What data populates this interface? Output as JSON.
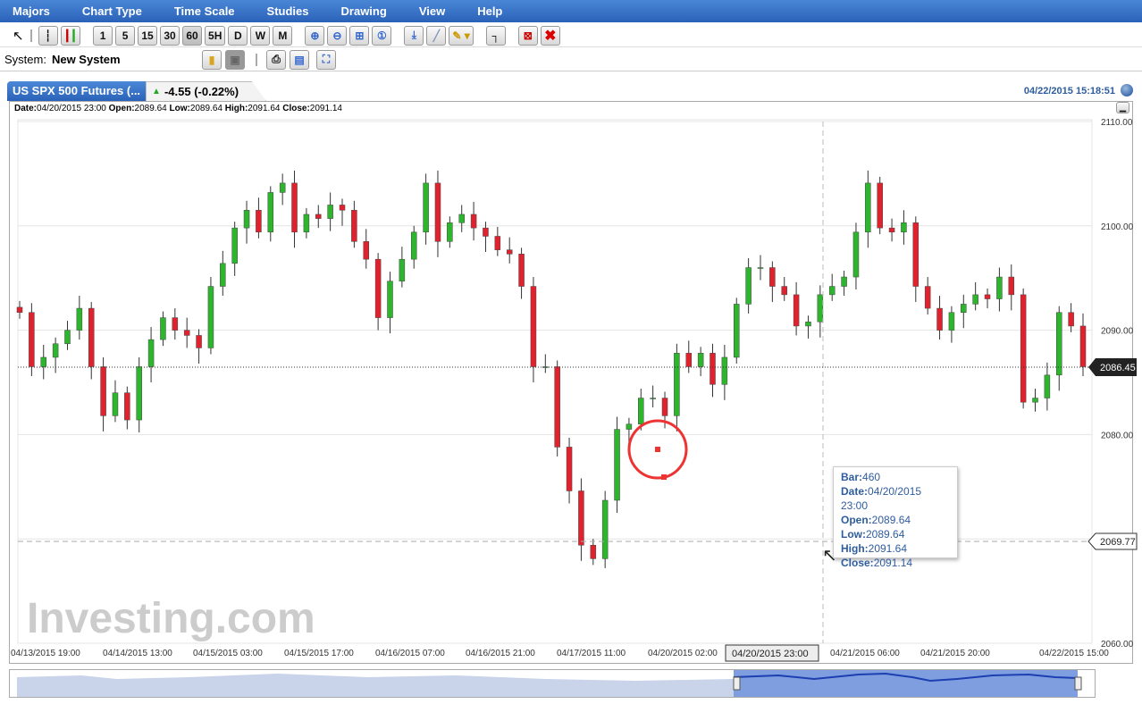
{
  "menu": [
    "Majors",
    "Chart Type",
    "Time Scale",
    "Studies",
    "Drawing",
    "View",
    "Help"
  ],
  "toolbar": {
    "intervals": [
      "1",
      "5",
      "15",
      "30",
      "60",
      "5H",
      "D",
      "W",
      "M"
    ],
    "active_interval": "60"
  },
  "system": {
    "label": "System:",
    "name": "New System"
  },
  "tab": {
    "title": "US SPX 500 Futures (...",
    "change": "-4.55 (-0.22%)"
  },
  "datetime": "04/22/2015 15:18:51",
  "info_line": {
    "date_label": "Date:",
    "date": "04/20/2015 23:00",
    "open_label": "Open:",
    "open": "2089.64",
    "low_label": "Low:",
    "low": "2089.64",
    "high_label": "High:",
    "high": "2091.64",
    "close_label": "Close:",
    "close": "2091.14"
  },
  "tooltip": {
    "bar_label": "Bar:",
    "bar": "460",
    "date_label": "Date:",
    "date": "04/20/2015 23:00",
    "open_label": "Open:",
    "open": "2089.64",
    "low_label": "Low:",
    "low": "2089.64",
    "high_label": "High:",
    "high": "2091.64",
    "close_label": "Close:",
    "close": "2091.14"
  },
  "watermark": "Investing.com",
  "chart_data": {
    "type": "candlestick",
    "ylim": [
      2060,
      2110
    ],
    "yticks": [
      "2110.00",
      "2100.00",
      "2090.00",
      "2080.00",
      "2070.00",
      "2060.00"
    ],
    "xticks": [
      "04/13/2015 19:00",
      "04/14/2015 13:00",
      "04/15/2015 03:00",
      "04/15/2015 17:00",
      "04/16/2015 07:00",
      "04/16/2015 21:00",
      "04/17/2015 11:00",
      "04/20/2015 02:00",
      "04/21/2015 06:00",
      "04/21/2015 20:00",
      "04/22/2015 15:00"
    ],
    "crosshair_x_label": "04/20/2015 23:00",
    "last_price": "2086.45",
    "crosshair_price": "2069.77",
    "closes": [
      2091.7,
      2086.5,
      2087.4,
      2088.7,
      2090,
      2092.1,
      2086.5,
      2081.8,
      2084,
      2081.4,
      2086.5,
      2089.1,
      2091.2,
      2090,
      2089.5,
      2088.3,
      2094.2,
      2096.4,
      2099.8,
      2101.5,
      2099.4,
      2103.2,
      2104.1,
      2099.4,
      2101.1,
      2100.7,
      2102,
      2101.5,
      2098.5,
      2096.8,
      2091.2,
      2094.7,
      2096.8,
      2099.4,
      2104.1,
      2098.5,
      2100.3,
      2101.1,
      2099.8,
      2099,
      2097.7,
      2097.3,
      2094.2,
      2086.5,
      2086.5,
      2078.8,
      2074.6,
      2069.4,
      2068.1,
      2073.7,
      2080.5,
      2081,
      2083.5,
      2083.5,
      2081.8,
      2087.8,
      2086.5,
      2087.8,
      2084.8,
      2087.4,
      2092.5,
      2096,
      2096,
      2094.2,
      2093.4,
      2090.4,
      2090.8,
      2093.4,
      2094.2,
      2095.1,
      2099.4,
      2104.1,
      2099.8,
      2099.4,
      2100.3,
      2094.2,
      2092.1,
      2090,
      2091.7,
      2092.5,
      2093.4,
      2093,
      2095.1,
      2093.4,
      2083.1,
      2083.5,
      2085.7,
      2091.7,
      2090.4,
      2086.5
    ]
  }
}
